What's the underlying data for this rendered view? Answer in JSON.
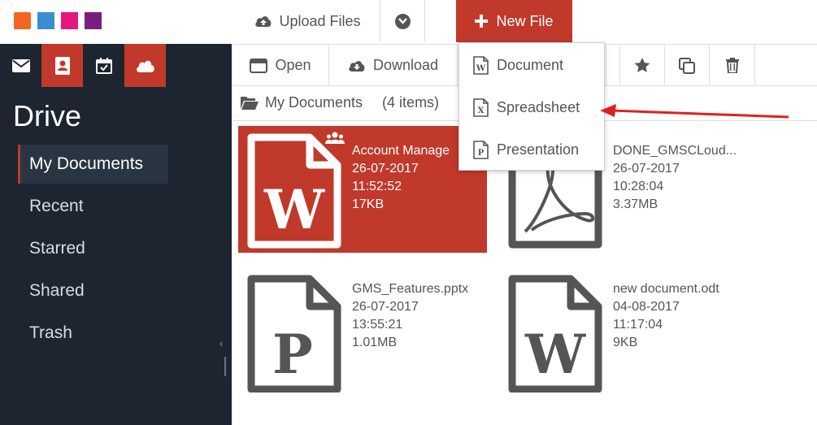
{
  "header": {
    "logo_colors": [
      "#f26522",
      "#3b8ed0",
      "#e6177a",
      "#7b1f7e"
    ],
    "upload_label": "Upload Files",
    "new_file_label": "New File"
  },
  "sidebar": {
    "title": "Drive",
    "icons": [
      "mail-icon",
      "contacts-icon",
      "calendar-icon",
      "cloud-icon"
    ],
    "items": [
      {
        "label": "My Documents",
        "active": true
      },
      {
        "label": "Recent"
      },
      {
        "label": "Starred"
      },
      {
        "label": "Shared"
      },
      {
        "label": "Trash"
      }
    ]
  },
  "toolbar": {
    "open_label": "Open",
    "download_label": "Download"
  },
  "breadcrumb": {
    "folder": "My Documents",
    "count": "(4 items)"
  },
  "new_file_menu": {
    "items": [
      {
        "label": "Document",
        "glyph": "W"
      },
      {
        "label": "Spreadsheet",
        "glyph": "X"
      },
      {
        "label": "Presentation",
        "glyph": "P"
      }
    ]
  },
  "files": [
    {
      "name": "Account Manage",
      "date": "26-07-2017",
      "time": "11:52:52",
      "size": "17KB",
      "type": "word",
      "selected": true
    },
    {
      "name": "DONE_GMSCLoud...",
      "date": "26-07-2017",
      "time": "10:28:04",
      "size": "3.37MB",
      "type": "pdf"
    },
    {
      "name": "GMS_Features.pptx",
      "date": "26-07-2017",
      "time": "13:55:21",
      "size": "1.01MB",
      "type": "ppt"
    },
    {
      "name": "new document.odt",
      "date": "04-08-2017",
      "time": "11:17:04",
      "size": "9KB",
      "type": "word"
    }
  ],
  "colors": {
    "accent": "#c0392b",
    "sidebar_bg": "#1d2530",
    "annotation_arrow": "#e02020"
  }
}
